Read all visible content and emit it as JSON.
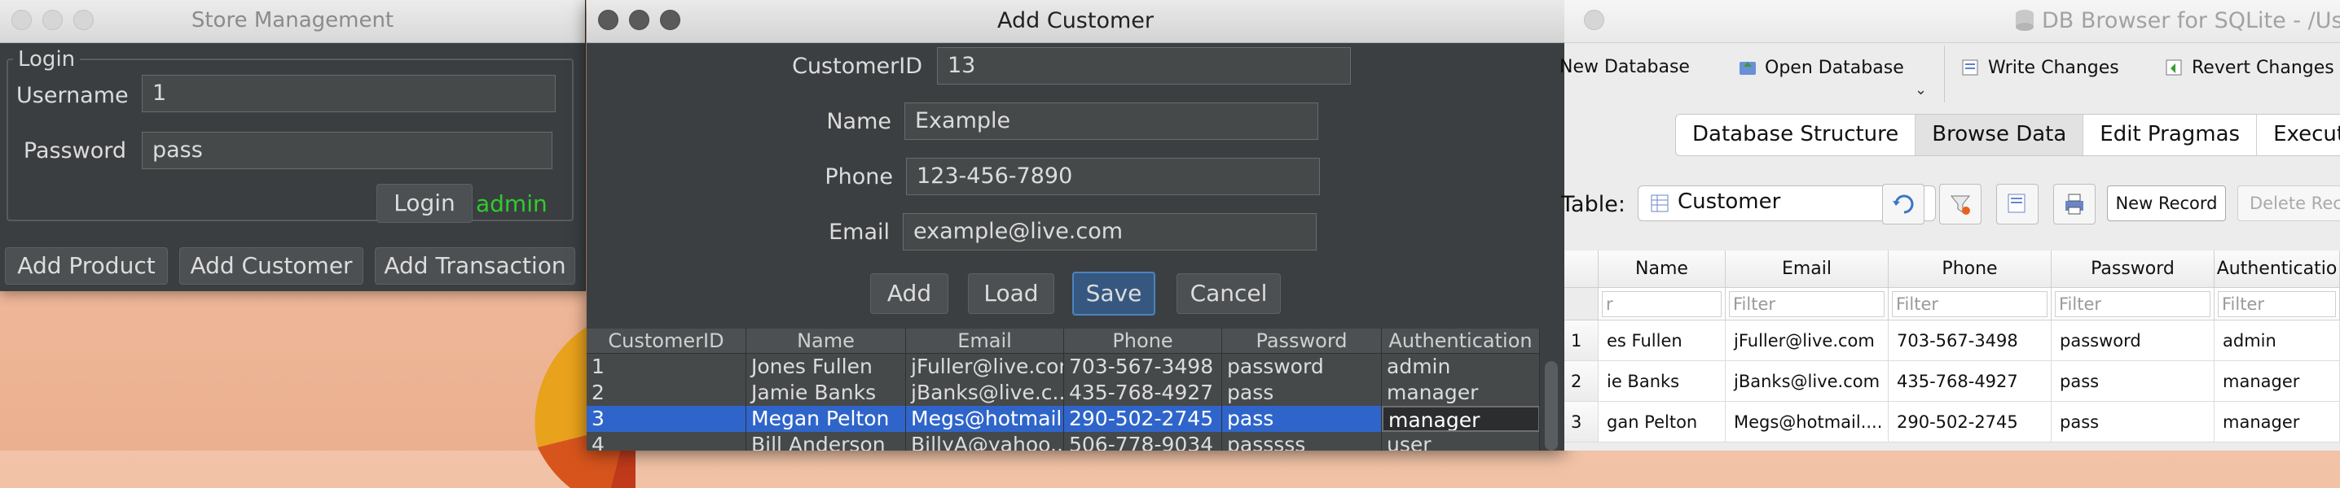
{
  "store": {
    "title": "Store Management",
    "login_legend": "Login",
    "username_label": "Username",
    "username_value": "1",
    "password_label": "Password",
    "password_value": "pass",
    "login_button": "Login",
    "login_status": "admin",
    "status_color": "#2ecc2e",
    "add_product": "Add Product",
    "add_customer": "Add Customer",
    "add_transaction": "Add Transaction"
  },
  "add_customer": {
    "title": "Add Customer",
    "fields": {
      "customer_id_label": "CustomerID",
      "customer_id_value": "13",
      "name_label": "Name",
      "name_value": "Example",
      "phone_label": "Phone",
      "phone_value": "123-456-7890",
      "email_label": "Email",
      "email_value": "example@live.com"
    },
    "buttons": {
      "add": "Add",
      "load": "Load",
      "save": "Save",
      "cancel": "Cancel"
    },
    "table": {
      "columns": [
        "CustomerID",
        "Name",
        "Email",
        "Phone",
        "Password",
        "Authentication"
      ],
      "rows": [
        [
          "1",
          "Jones Fullen",
          "jFuller@live.com",
          "703-567-3498",
          "password",
          "admin"
        ],
        [
          "2",
          "Jamie Banks",
          "jBanks@live.c...",
          "435-768-4927",
          "pass",
          "manager"
        ],
        [
          "3",
          "Megan Pelton",
          "Megs@hotmail...",
          "290-502-2745",
          "pass",
          "manager"
        ],
        [
          "4",
          "Bill Anderson",
          "BillyA@yahoo....",
          "506-778-9034",
          "passsss",
          "user"
        ]
      ],
      "selected_row": 3
    }
  },
  "db_browser": {
    "title": "DB Browser for SQLite - /User",
    "toolbar": {
      "new_database": "New Database",
      "open_database": "Open Database",
      "write_changes": "Write Changes",
      "revert_changes": "Revert Changes"
    },
    "tabs": [
      "Database Structure",
      "Browse Data",
      "Edit Pragmas",
      "Execute SQL"
    ],
    "active_tab": "Browse Data",
    "table_label": "Table:",
    "table_select": "Customer",
    "new_record": "New Record",
    "delete_record": "Delete Reco",
    "grid": {
      "columns": [
        "Name",
        "Email",
        "Phone",
        "Password",
        "Authenticatio"
      ],
      "filter_placeholder": "Filter",
      "first_filter": "r",
      "rows": [
        [
          "1",
          "es Fullen",
          "jFuller@live.com",
          "703-567-3498",
          "password",
          "admin"
        ],
        [
          "2",
          "ie Banks",
          "jBanks@live.com",
          "435-768-4927",
          "pass",
          "manager"
        ],
        [
          "3",
          "gan Pelton",
          "Megs@hotmail....",
          "290-502-2745",
          "pass",
          "manager"
        ]
      ]
    }
  }
}
